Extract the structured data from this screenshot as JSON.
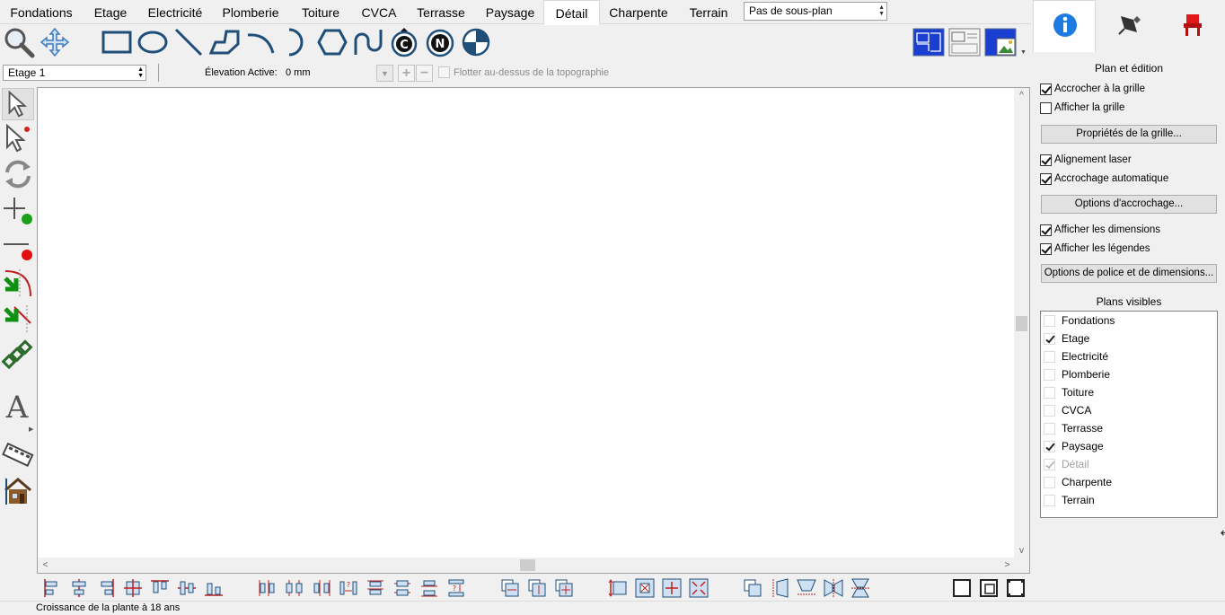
{
  "tabs": [
    {
      "label": "Fondations"
    },
    {
      "label": "Etage"
    },
    {
      "label": "Electricité"
    },
    {
      "label": "Plomberie"
    },
    {
      "label": "Toiture"
    },
    {
      "label": "CVCA"
    },
    {
      "label": "Terrasse"
    },
    {
      "label": "Paysage"
    },
    {
      "label": "Détail",
      "active": true
    },
    {
      "label": "Charpente"
    },
    {
      "label": "Terrain"
    }
  ],
  "subplan": {
    "value": "Pas de sous-plan"
  },
  "drawing_tools": [
    "zoom-icon",
    "pan-icon",
    "rectangle-icon",
    "ellipse-icon",
    "line-icon",
    "polyline-icon",
    "arc-icon",
    "half-circle-icon",
    "hexagon-icon",
    "spline-icon",
    "copyright-icon",
    "north-arrow-icon",
    "target-icon"
  ],
  "view_tools": [
    "plan-view-icon",
    "layout-view-icon",
    "photo-view-icon"
  ],
  "options": {
    "floor_value": "Etage 1",
    "elevation_label": "Élevation Active:",
    "elevation_value": "0 mm",
    "float_label": "Flotter au-dessus de la topographie"
  },
  "left_tools": [
    "select-arrow-icon",
    "select-special-icon",
    "rotate-icon",
    "add-point-icon",
    "delete-point-icon",
    "fillet-icon",
    "chamfer-icon",
    "chain-icon",
    "text-icon",
    "film-icon",
    "house-icon"
  ],
  "status": {
    "text": "Croissance de la plante à 18 ans"
  },
  "panel": {
    "tabs": [
      "info-icon",
      "pen-icon",
      "chair-icon"
    ],
    "section_title": "Plan et édition",
    "snap_grid": {
      "label": "Accrocher à la grille",
      "checked": true
    },
    "show_grid": {
      "label": "Afficher la grille",
      "checked": false
    },
    "grid_props_btn": "Propriétés de la grille...",
    "laser": {
      "label": "Alignement laser",
      "checked": true
    },
    "auto_snap": {
      "label": "Accrochage automatique",
      "checked": true
    },
    "snap_options_btn": "Options d'accrochage...",
    "show_dims": {
      "label": "Afficher les dimensions",
      "checked": true
    },
    "show_legends": {
      "label": "Afficher les légendes",
      "checked": true
    },
    "font_dims_btn": "Options de police et de dimensions...",
    "plans_title": "Plans visibles",
    "plans": [
      {
        "label": "Fondations",
        "checked": false
      },
      {
        "label": "Etage",
        "checked": true
      },
      {
        "label": "Electricité",
        "checked": false
      },
      {
        "label": "Plomberie",
        "checked": false
      },
      {
        "label": "Toiture",
        "checked": false
      },
      {
        "label": "CVCA",
        "checked": false
      },
      {
        "label": "Terrasse",
        "checked": false
      },
      {
        "label": "Paysage",
        "checked": true
      },
      {
        "label": "Détail",
        "checked": true,
        "disabled": true
      },
      {
        "label": "Charpente",
        "checked": false
      },
      {
        "label": "Terrain",
        "checked": false
      }
    ]
  }
}
